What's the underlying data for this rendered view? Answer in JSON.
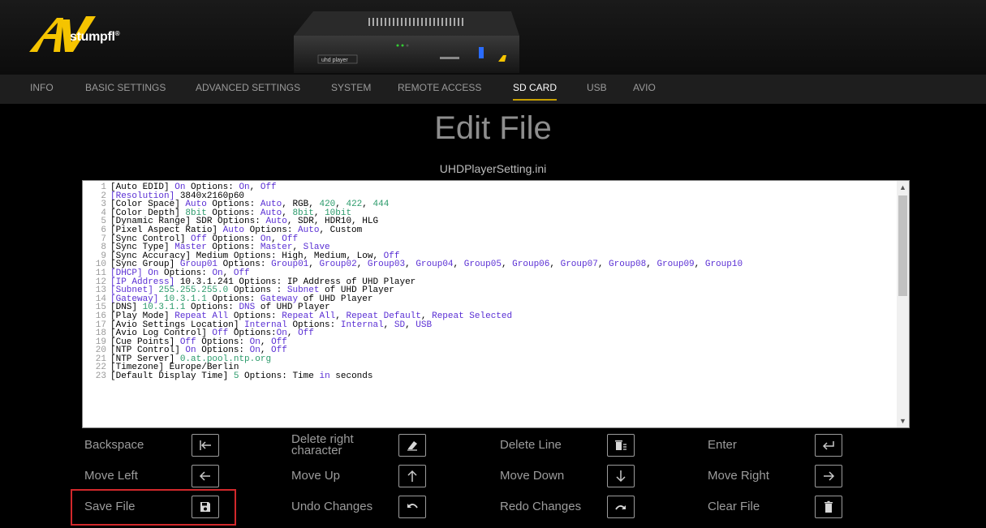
{
  "brand": {
    "logo_text": "stumpfl",
    "logo_mark": "AV",
    "registered": "®"
  },
  "device": {
    "label": "uhd player"
  },
  "nav": {
    "tabs": [
      {
        "label": "INFO",
        "active": false
      },
      {
        "label": "BASIC SETTINGS",
        "active": false
      },
      {
        "label": "ADVANCED SETTINGS",
        "active": false
      },
      {
        "label": "SYSTEM",
        "active": false
      },
      {
        "label": "REMOTE ACCESS",
        "active": false
      },
      {
        "label": "SD CARD",
        "active": true
      },
      {
        "label": "USB",
        "active": false
      },
      {
        "label": "AVIO",
        "active": false
      }
    ]
  },
  "page": {
    "title": "Edit File",
    "file_name": "UHDPlayerSetting.ini"
  },
  "editor": {
    "lines": [
      "1|[Auto EDID] {v:On} Options: {v:On}, {v:Off}",
      "2|{v:[Resolution]} 3840x2160p60",
      "3|[Color Space] {v:Auto} Options: {v:Auto}, RGB, {g:420}, {g:422}, {g:444}",
      "4|[Color Depth] {g:8bit} Options: {v:Auto}, {g:8bit}, {g:10bit}",
      "5|[Dynamic Range] SDR Options: {v:Auto}, SDR, HDR10, HLG",
      "6|[Pixel Aspect Ratio] {v:Auto} Options: {v:Auto}, Custom",
      "7|[Sync Control] {v:Off} Options: {v:On}, {v:Off}",
      "8|[Sync Type] {v:Master} Options: {v:Master}, {v:Slave}",
      "9|[Sync Accuracy] Medium Options: High, Medium, Low, {v:Off}",
      "10|[Sync Group] {v:Group01} Options: {v:Group01}, {v:Group02}, {v:Group03}, {v:Group04}, {v:Group05}, {v:Group06}, {v:Group07}, {v:Group08}, {v:Group09}, {v:Group10}",
      "11|{v:[DHCP]} {v:On} Options: {v:On}, {v:Off}",
      "12|{v:[IP Address]} 10.3.1.241 Options: IP Address of UHD Player",
      "13|{v:[Subnet]} {g:255.255.255.0} Options : {v:Subnet} of UHD Player",
      "14|{v:[Gateway]} {g:10.3.1.1} Options: {v:Gateway} of UHD Player",
      "15|[DNS] {g:10.3.1.1} Options: {v:DNS} of UHD Player",
      "16|[Play Mode] {v:Repeat All} Options: {v:Repeat All}, {v:Repeat Default}, {v:Repeat Selected}",
      "17|[Avio Settings Location] {v:Internal} Options: {v:Internal}, {v:SD}, {v:USB}",
      "18|[Avio Log Control] {v:Off} Options:{v:On}, {v:Off}",
      "19|[Cue Points] {v:Off} Options: {v:On}, {v:Off}",
      "20|[NTP Control] {v:On} Options: {v:On}, {v:Off}",
      "21|[NTP Server] {g:0.at.pool.ntp.org}",
      "22|[Timezone] Europe/Berlin",
      "23|[Default Display Time] {g:5} Options: Time {v:in} seconds"
    ]
  },
  "controls": [
    {
      "id": "backspace",
      "label": "Backspace",
      "icon": "arrow-to-left-icon"
    },
    {
      "id": "delete-right",
      "label": "Delete right character",
      "icon": "eraser-icon"
    },
    {
      "id": "delete-line",
      "label": "Delete Line",
      "icon": "trash-lines-icon"
    },
    {
      "id": "enter",
      "label": "Enter",
      "icon": "enter-icon"
    },
    {
      "id": "move-left",
      "label": "Move Left",
      "icon": "arrow-left-icon"
    },
    {
      "id": "move-up",
      "label": "Move Up",
      "icon": "arrow-up-icon"
    },
    {
      "id": "move-down",
      "label": "Move Down",
      "icon": "arrow-down-icon"
    },
    {
      "id": "move-right",
      "label": "Move Right",
      "icon": "arrow-right-icon"
    },
    {
      "id": "save-file",
      "label": "Save File",
      "icon": "floppy-disk-icon"
    },
    {
      "id": "undo",
      "label": "Undo Changes",
      "icon": "undo-icon"
    },
    {
      "id": "redo",
      "label": "Redo Changes",
      "icon": "redo-icon"
    },
    {
      "id": "clear-file",
      "label": "Clear File",
      "icon": "trash-icon"
    }
  ],
  "colors": {
    "active_tab_underline": "#c8a000",
    "highlight": "#d2282b",
    "value_purple": "#5a2fd4",
    "value_green": "#2a9a6a"
  }
}
